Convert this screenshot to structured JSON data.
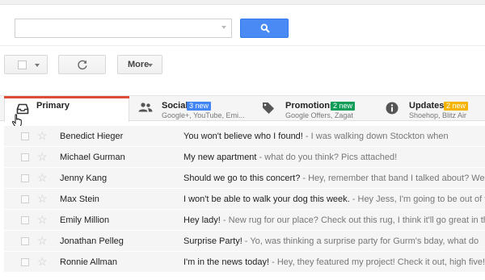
{
  "search": {
    "value": "",
    "placeholder": ""
  },
  "toolbar": {
    "more_label": "More"
  },
  "tabs": [
    {
      "label": "Primary"
    },
    {
      "label": "Social",
      "badge": "3 new",
      "subtitle": "Google+, YouTube, Emi..."
    },
    {
      "label": "Promotions",
      "badge": "2 new",
      "subtitle": "Google Offers, Zagat"
    },
    {
      "label": "Updates",
      "badge": "2 new",
      "subtitle": "Shoehop, Blitz Air"
    }
  ],
  "emails": [
    {
      "sender": "Benedict Hieger",
      "subject": "You won't believe who I found!",
      "snippet": " - I was walking down Stockton when"
    },
    {
      "sender": "Michael Gurman",
      "subject": "My new apartment",
      "snippet": " - what do you think? Pics attached!"
    },
    {
      "sender": "Jenny Kang",
      "subject": "Should we go to this concert?",
      "snippet": " - Hey, remember that band I talked about? Well"
    },
    {
      "sender": "Max Stein",
      "subject": "I won't be able to walk your dog this week.",
      "snippet": " - Hey Jess, I'm going to be out of town"
    },
    {
      "sender": "Emily Million",
      "subject": "Hey lady!",
      "snippet": " - New rug for our place? Check out this rug, I think it'll go great in the space"
    },
    {
      "sender": "Jonathan Pelleg",
      "subject": "Surprise Party!",
      "snippet": " - Yo, was thinking a surprise party for Gurm's bday, what do"
    },
    {
      "sender": "Ronnie Allman",
      "subject": "I'm in the news today!",
      "snippet": " - Hey, they featured my project! Check it out, high five!"
    }
  ],
  "colors": {
    "search_button": "#4a8af4",
    "primary_tab_accent": "#dd4b39",
    "social_badge": "#4285f4",
    "promotions_badge": "#0f9d58",
    "updates_badge": "#f4b400"
  },
  "icons": {
    "search_button": "search-icon",
    "refresh": "refresh-icon",
    "primary_tab": "inbox-icon",
    "social_tab": "people-icon",
    "promotions_tab": "tag-icon",
    "updates_tab": "info-icon",
    "cursor": "hand-cursor-icon",
    "row_star": "star-icon"
  }
}
